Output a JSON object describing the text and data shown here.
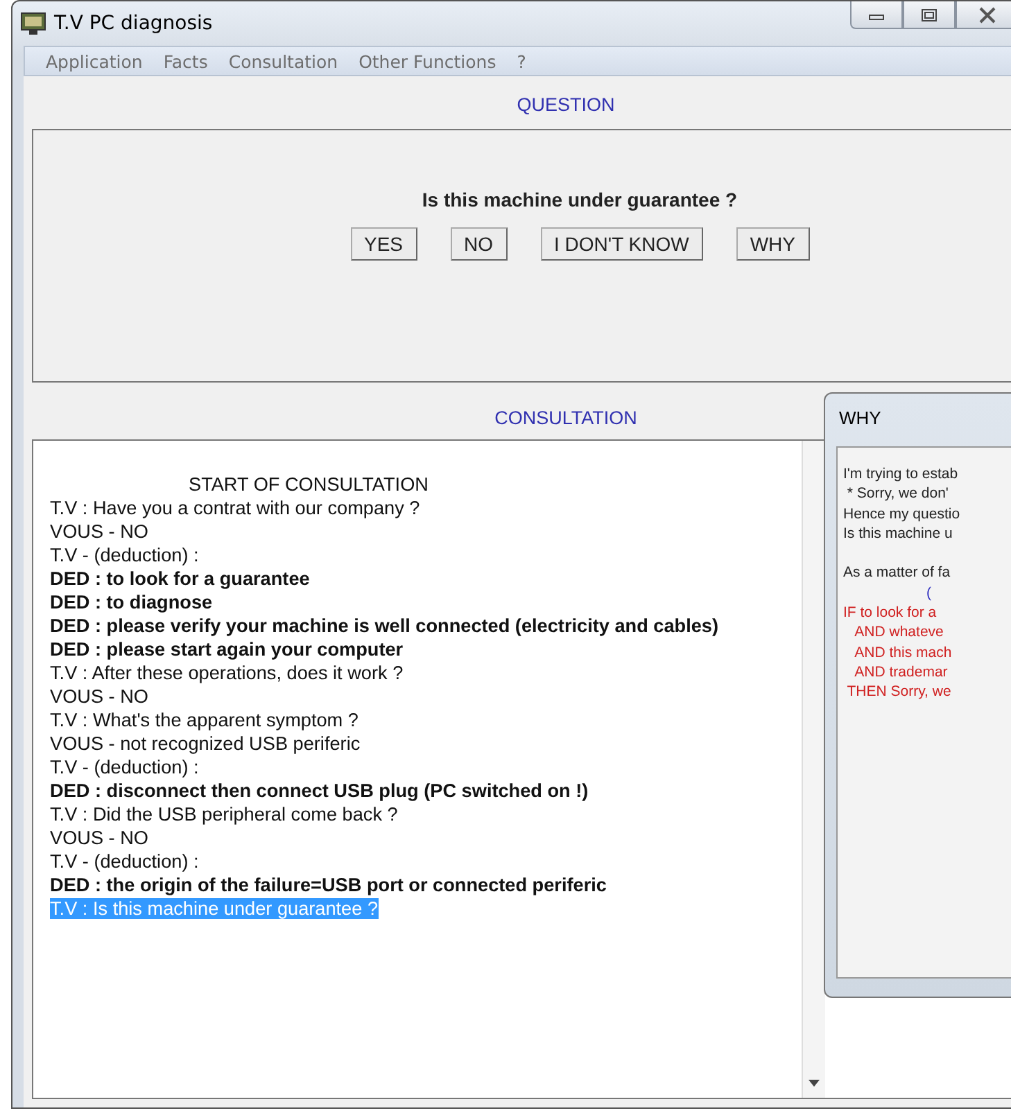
{
  "window": {
    "title": "T.V PC diagnosis"
  },
  "menu": [
    {
      "label": "Application"
    },
    {
      "label": "Facts"
    },
    {
      "label": "Consultation"
    },
    {
      "label": "Other Functions"
    },
    {
      "label": "?"
    }
  ],
  "question_panel": {
    "heading": "QUESTION",
    "question": "Is this machine under guarantee ?",
    "buttons": [
      "YES",
      "NO",
      "I DON'T KNOW",
      "WHY"
    ]
  },
  "consultation_panel": {
    "heading": "CONSULTATION",
    "lines": [
      {
        "kind": "title",
        "text": "START OF CONSULTATION",
        "selected": false
      },
      {
        "kind": "plain",
        "text": "T.V : Have you a contrat with our company ?",
        "selected": false
      },
      {
        "kind": "plain",
        "text": "VOUS - NO",
        "selected": false
      },
      {
        "kind": "plain",
        "text": "T.V - (deduction) :",
        "selected": false
      },
      {
        "kind": "bold",
        "text": "DED : to look for a guarantee",
        "selected": false
      },
      {
        "kind": "bold",
        "text": "DED : to diagnose",
        "selected": false
      },
      {
        "kind": "bold",
        "text": "DED : please verify your machine is well connected (electricity and cables)",
        "selected": false
      },
      {
        "kind": "bold",
        "text": "DED : please start again your computer",
        "selected": false
      },
      {
        "kind": "plain",
        "text": "T.V : After these operations, does it work ?",
        "selected": false
      },
      {
        "kind": "plain",
        "text": "VOUS - NO",
        "selected": false
      },
      {
        "kind": "plain",
        "text": "T.V : What's the apparent symptom ?",
        "selected": false
      },
      {
        "kind": "plain",
        "text": "VOUS - not recognized USB periferic",
        "selected": false
      },
      {
        "kind": "plain",
        "text": "T.V - (deduction) :",
        "selected": false
      },
      {
        "kind": "bold",
        "text": "DED : disconnect then connect USB  plug (PC switched on !)",
        "selected": false
      },
      {
        "kind": "plain",
        "text": "T.V : Did the USB peripheral come back ?",
        "selected": false
      },
      {
        "kind": "plain",
        "text": "VOUS - NO",
        "selected": false
      },
      {
        "kind": "plain",
        "text": "T.V - (deduction) :",
        "selected": false
      },
      {
        "kind": "bold",
        "text": "DED : the origin of the failure=USB port or connected periferic",
        "selected": false
      },
      {
        "kind": "plain",
        "text": "T.V : Is this machine under guarantee ?",
        "selected": true
      }
    ]
  },
  "why_dialog": {
    "title": "WHY",
    "lines": [
      {
        "kind": "plain",
        "text": "I'm trying to estab"
      },
      {
        "kind": "plain",
        "text": " * Sorry, we don'"
      },
      {
        "kind": "plain",
        "text": "Hence my questio"
      },
      {
        "kind": "plain",
        "text": "Is this machine u"
      },
      {
        "kind": "fact",
        "text": "As a matter of fa"
      },
      {
        "kind": "note",
        "text": "("
      },
      {
        "kind": "rule",
        "text": "IF to look for a"
      },
      {
        "kind": "rule",
        "text": "   AND whateve"
      },
      {
        "kind": "rule",
        "text": "   AND this mach"
      },
      {
        "kind": "rule",
        "text": "   AND trademar"
      },
      {
        "kind": "rule",
        "text": " THEN Sorry, we"
      }
    ]
  }
}
